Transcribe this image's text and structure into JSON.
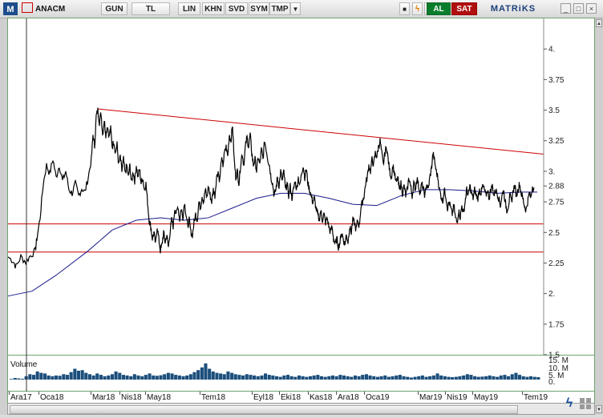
{
  "toolbar": {
    "menu_icon_label": "M",
    "symbol": "ANACM",
    "buttons": [
      "GUN",
      "TL",
      "LIN",
      "KHN",
      "SVD",
      "SYM",
      "TMP"
    ],
    "buy_label": "AL",
    "sell_label": "SAT",
    "brand": "MATRiKS"
  },
  "volume_label": "Volume",
  "colors": {
    "price_line": "#000000",
    "moving_average": "#1a1a8c",
    "trend_line": "#cc0000",
    "support_line": "#cc0000",
    "volume_bar": "#1c4f7c",
    "buy": "#0a7d2c",
    "sell": "#b01010"
  },
  "chart_data": {
    "type": "line",
    "series": [],
    "y_ticks": [
      "4.",
      "3.75",
      "3.5",
      "3.25",
      "3.",
      "2.88",
      "2.75",
      "2.5",
      "2.25",
      "2.",
      "1.75",
      "1.5"
    ],
    "y_tick_values": [
      4.0,
      3.75,
      3.5,
      3.25,
      3.0,
      2.88,
      2.75,
      2.5,
      2.25,
      2.0,
      1.75,
      1.5
    ],
    "ylim": [
      1.5,
      4.25
    ],
    "last_value": 2.88,
    "x_ticks": [
      "Ara17",
      "Oca18",
      "Mar18",
      "Nis18",
      "May18",
      "Tem18",
      "Eyl18",
      "Eki18",
      "Kas18",
      "Ara18",
      "Oca19",
      "Mar19",
      "Nis19",
      "May19",
      "Tem19"
    ],
    "volume_ticks": [
      "15. M",
      "10. M",
      "5. M",
      "0."
    ],
    "price_path": [
      [
        0,
        2.3
      ],
      [
        6,
        2.27
      ],
      [
        10,
        2.22
      ],
      [
        16,
        2.3
      ],
      [
        22,
        2.26
      ],
      [
        28,
        2.31
      ],
      [
        34,
        2.35
      ],
      [
        36,
        2.45
      ],
      [
        40,
        2.62
      ],
      [
        44,
        2.9
      ],
      [
        48,
        3.05
      ],
      [
        52,
        2.98
      ],
      [
        56,
        3.1
      ],
      [
        60,
        2.95
      ],
      [
        64,
        3.05
      ],
      [
        68,
        2.92
      ],
      [
        72,
        3.0
      ],
      [
        76,
        2.85
      ],
      [
        80,
        2.82
      ],
      [
        84,
        2.9
      ],
      [
        88,
        2.8
      ],
      [
        92,
        2.86
      ],
      [
        96,
        2.83
      ],
      [
        100,
        2.95
      ],
      [
        104,
        3.1
      ],
      [
        106,
        3.3
      ],
      [
        108,
        3.2
      ],
      [
        110,
        3.45
      ],
      [
        112,
        3.5
      ],
      [
        114,
        3.4
      ],
      [
        116,
        3.48
      ],
      [
        118,
        3.3
      ],
      [
        120,
        3.42
      ],
      [
        122,
        3.3
      ],
      [
        124,
        3.38
      ],
      [
        126,
        3.28
      ],
      [
        128,
        3.35
      ],
      [
        130,
        3.2
      ],
      [
        132,
        3.25
      ],
      [
        134,
        3.15
      ],
      [
        136,
        3.22
      ],
      [
        138,
        3.05
      ],
      [
        140,
        3.12
      ],
      [
        142,
        3.0
      ],
      [
        144,
        3.1
      ],
      [
        146,
        2.98
      ],
      [
        148,
        3.05
      ],
      [
        150,
        2.95
      ],
      [
        152,
        3.05
      ],
      [
        154,
        2.9
      ],
      [
        156,
        3.0
      ],
      [
        158,
        2.92
      ],
      [
        160,
        3.05
      ],
      [
        162,
        2.95
      ],
      [
        164,
        3.02
      ],
      [
        166,
        2.9
      ],
      [
        168,
        2.95
      ],
      [
        170,
        2.85
      ],
      [
        172,
        2.9
      ],
      [
        174,
        2.75
      ],
      [
        176,
        2.6
      ],
      [
        178,
        2.55
      ],
      [
        180,
        2.45
      ],
      [
        182,
        2.5
      ],
      [
        184,
        2.4
      ],
      [
        186,
        2.55
      ],
      [
        188,
        2.45
      ],
      [
        190,
        2.35
      ],
      [
        192,
        2.4
      ],
      [
        194,
        2.5
      ],
      [
        196,
        2.42
      ],
      [
        198,
        2.48
      ],
      [
        200,
        2.38
      ],
      [
        202,
        2.5
      ],
      [
        204,
        2.6
      ],
      [
        206,
        2.55
      ],
      [
        208,
        2.7
      ],
      [
        210,
        2.65
      ],
      [
        212,
        2.72
      ],
      [
        214,
        2.6
      ],
      [
        216,
        2.7
      ],
      [
        218,
        2.62
      ],
      [
        220,
        2.75
      ],
      [
        222,
        2.65
      ],
      [
        224,
        2.55
      ],
      [
        226,
        2.6
      ],
      [
        228,
        2.5
      ],
      [
        230,
        2.48
      ],
      [
        232,
        2.58
      ],
      [
        234,
        2.65
      ],
      [
        236,
        2.6
      ],
      [
        238,
        2.75
      ],
      [
        240,
        2.7
      ],
      [
        242,
        2.8
      ],
      [
        244,
        2.75
      ],
      [
        246,
        2.85
      ],
      [
        248,
        2.78
      ],
      [
        250,
        2.88
      ],
      [
        252,
        2.8
      ],
      [
        254,
        2.75
      ],
      [
        256,
        2.85
      ],
      [
        258,
        2.8
      ],
      [
        260,
        2.95
      ],
      [
        262,
        3.0
      ],
      [
        264,
        2.92
      ],
      [
        266,
        3.1
      ],
      [
        268,
        3.05
      ],
      [
        270,
        3.15
      ],
      [
        272,
        3.2
      ],
      [
        274,
        3.12
      ],
      [
        276,
        3.3
      ],
      [
        278,
        3.25
      ],
      [
        280,
        3.38
      ],
      [
        282,
        3.1
      ],
      [
        284,
        2.95
      ],
      [
        286,
        3.0
      ],
      [
        288,
        2.9
      ],
      [
        290,
        3.05
      ],
      [
        292,
        3.15
      ],
      [
        294,
        3.05
      ],
      [
        296,
        3.2
      ],
      [
        298,
        3.28
      ],
      [
        300,
        3.2
      ],
      [
        302,
        3.3
      ],
      [
        304,
        3.15
      ],
      [
        306,
        3.05
      ],
      [
        308,
        3.1
      ],
      [
        310,
        3.0
      ],
      [
        312,
        3.12
      ],
      [
        314,
        3.05
      ],
      [
        316,
        3.18
      ],
      [
        318,
        3.1
      ],
      [
        320,
        3.25
      ],
      [
        322,
        3.18
      ],
      [
        324,
        3.1
      ],
      [
        326,
        3.05
      ],
      [
        328,
        2.95
      ],
      [
        330,
        2.9
      ],
      [
        332,
        2.8
      ],
      [
        334,
        2.85
      ],
      [
        336,
        2.95
      ],
      [
        338,
        2.88
      ],
      [
        340,
        3.0
      ],
      [
        342,
        2.92
      ],
      [
        344,
        3.0
      ],
      [
        346,
        2.85
      ],
      [
        348,
        2.9
      ],
      [
        350,
        2.8
      ],
      [
        352,
        2.88
      ],
      [
        354,
        2.78
      ],
      [
        356,
        2.85
      ],
      [
        358,
        2.92
      ],
      [
        360,
        2.85
      ],
      [
        362,
        2.95
      ],
      [
        364,
        2.88
      ],
      [
        366,
        2.98
      ],
      [
        368,
        3.05
      ],
      [
        370,
        2.95
      ],
      [
        372,
        3.02
      ],
      [
        374,
        2.9
      ],
      [
        376,
        2.85
      ],
      [
        378,
        2.8
      ],
      [
        380,
        2.75
      ],
      [
        382,
        2.78
      ],
      [
        384,
        2.7
      ],
      [
        386,
        2.65
      ],
      [
        388,
        2.6
      ],
      [
        390,
        2.68
      ],
      [
        392,
        2.6
      ],
      [
        394,
        2.65
      ],
      [
        396,
        2.58
      ],
      [
        398,
        2.62
      ],
      [
        400,
        2.55
      ],
      [
        402,
        2.5
      ],
      [
        404,
        2.55
      ],
      [
        406,
        2.45
      ],
      [
        408,
        2.4
      ],
      [
        410,
        2.45
      ],
      [
        412,
        2.38
      ],
      [
        414,
        2.42
      ],
      [
        416,
        2.5
      ],
      [
        418,
        2.45
      ],
      [
        420,
        2.4
      ],
      [
        422,
        2.48
      ],
      [
        424,
        2.42
      ],
      [
        426,
        2.55
      ],
      [
        428,
        2.5
      ],
      [
        430,
        2.6
      ],
      [
        432,
        2.58
      ],
      [
        434,
        2.52
      ],
      [
        436,
        2.6
      ],
      [
        438,
        2.55
      ],
      [
        440,
        2.7
      ],
      [
        442,
        2.75
      ],
      [
        444,
        2.8
      ],
      [
        446,
        2.9
      ],
      [
        448,
        2.95
      ],
      [
        450,
        3.05
      ],
      [
        452,
        3.0
      ],
      [
        454,
        3.1
      ],
      [
        456,
        3.05
      ],
      [
        458,
        3.15
      ],
      [
        460,
        3.12
      ],
      [
        462,
        3.2
      ],
      [
        464,
        3.25
      ],
      [
        466,
        3.15
      ],
      [
        468,
        3.05
      ],
      [
        470,
        3.15
      ],
      [
        472,
        3.2
      ],
      [
        474,
        3.1
      ],
      [
        476,
        3.0
      ],
      [
        478,
        2.95
      ],
      [
        480,
        3.05
      ],
      [
        482,
        2.98
      ],
      [
        484,
        2.9
      ],
      [
        486,
        2.95
      ],
      [
        488,
        2.85
      ],
      [
        490,
        2.9
      ],
      [
        492,
        2.82
      ],
      [
        494,
        2.88
      ],
      [
        496,
        2.8
      ],
      [
        498,
        2.85
      ],
      [
        500,
        2.95
      ],
      [
        502,
        2.88
      ],
      [
        504,
        2.8
      ],
      [
        506,
        2.9
      ],
      [
        508,
        2.85
      ],
      [
        510,
        2.95
      ],
      [
        512,
        2.88
      ],
      [
        514,
        2.82
      ],
      [
        516,
        2.9
      ],
      [
        518,
        2.85
      ],
      [
        520,
        2.8
      ],
      [
        522,
        2.9
      ],
      [
        524,
        2.85
      ],
      [
        526,
        2.95
      ],
      [
        528,
        3.02
      ],
      [
        530,
        3.15
      ],
      [
        532,
        3.08
      ],
      [
        534,
        3.0
      ],
      [
        536,
        2.95
      ],
      [
        538,
        2.85
      ],
      [
        540,
        2.8
      ],
      [
        542,
        2.75
      ],
      [
        544,
        2.85
      ],
      [
        546,
        2.8
      ],
      [
        548,
        2.7
      ],
      [
        550,
        2.75
      ],
      [
        552,
        2.7
      ],
      [
        554,
        2.65
      ],
      [
        556,
        2.72
      ],
      [
        558,
        2.62
      ],
      [
        560,
        2.58
      ],
      [
        562,
        2.68
      ],
      [
        564,
        2.62
      ],
      [
        566,
        2.72
      ],
      [
        568,
        2.65
      ],
      [
        570,
        2.75
      ],
      [
        572,
        2.85
      ],
      [
        574,
        2.8
      ],
      [
        576,
        2.88
      ],
      [
        578,
        2.82
      ],
      [
        580,
        2.78
      ],
      [
        582,
        2.85
      ],
      [
        584,
        2.8
      ],
      [
        586,
        2.78
      ],
      [
        588,
        2.85
      ],
      [
        590,
        2.82
      ],
      [
        592,
        2.88
      ],
      [
        594,
        2.85
      ],
      [
        596,
        2.8
      ],
      [
        598,
        2.85
      ],
      [
        600,
        2.78
      ],
      [
        602,
        2.85
      ],
      [
        604,
        2.88
      ],
      [
        606,
        2.8
      ],
      [
        608,
        2.85
      ],
      [
        610,
        2.82
      ],
      [
        612,
        2.78
      ],
      [
        614,
        2.72
      ],
      [
        616,
        2.8
      ],
      [
        618,
        2.85
      ],
      [
        620,
        2.75
      ],
      [
        622,
        2.68
      ],
      [
        624,
        2.72
      ],
      [
        626,
        2.8
      ],
      [
        628,
        2.75
      ],
      [
        630,
        2.85
      ],
      [
        632,
        2.88
      ],
      [
        634,
        2.8
      ],
      [
        636,
        2.85
      ],
      [
        638,
        2.9
      ],
      [
        640,
        2.82
      ],
      [
        642,
        2.78
      ],
      [
        644,
        2.72
      ],
      [
        646,
        2.68
      ],
      [
        648,
        2.75
      ],
      [
        650,
        2.82
      ],
      [
        652,
        2.78
      ],
      [
        654,
        2.88
      ],
      [
        656,
        2.85
      ]
    ],
    "moving_average_path": [
      [
        0,
        1.98
      ],
      [
        30,
        2.02
      ],
      [
        60,
        2.15
      ],
      [
        100,
        2.35
      ],
      [
        130,
        2.52
      ],
      [
        160,
        2.6
      ],
      [
        190,
        2.62
      ],
      [
        220,
        2.6
      ],
      [
        250,
        2.62
      ],
      [
        280,
        2.7
      ],
      [
        310,
        2.78
      ],
      [
        340,
        2.82
      ],
      [
        370,
        2.82
      ],
      [
        400,
        2.78
      ],
      [
        430,
        2.73
      ],
      [
        460,
        2.72
      ],
      [
        490,
        2.8
      ],
      [
        520,
        2.85
      ],
      [
        550,
        2.85
      ],
      [
        580,
        2.84
      ],
      [
        610,
        2.82
      ],
      [
        640,
        2.83
      ],
      [
        660,
        2.83
      ]
    ],
    "trend_line": [
      [
        112,
        3.51
      ],
      [
        668,
        3.14
      ]
    ],
    "support_levels": [
      2.57,
      2.34
    ],
    "volume_values": [
      0.5,
      1.2,
      0.8,
      0.6,
      2.5,
      4.0,
      3.5,
      6.0,
      5.0,
      4.5,
      3.0,
      2.5,
      3.0,
      2.8,
      4.0,
      3.5,
      5.5,
      8.0,
      6.5,
      7.0,
      5.0,
      4.0,
      3.0,
      4.5,
      3.5,
      2.5,
      3.0,
      4.0,
      6.0,
      5.0,
      3.5,
      3.0,
      2.5,
      4.0,
      3.0,
      2.5,
      3.5,
      4.5,
      3.0,
      2.8,
      3.2,
      4.0,
      5.0,
      4.5,
      3.5,
      3.0,
      2.5,
      3.0,
      4.0,
      5.5,
      7.0,
      9.0,
      12.0,
      8.0,
      6.0,
      5.0,
      4.5,
      4.0,
      6.0,
      5.0,
      4.0,
      3.5,
      3.0,
      4.0,
      3.5,
      3.0,
      2.5,
      3.0,
      4.5,
      3.5,
      3.0,
      2.5,
      2.0,
      3.0,
      3.5,
      2.5,
      2.0,
      3.0,
      2.5,
      2.0,
      2.5,
      3.0,
      3.5,
      2.5,
      2.0,
      2.5,
      3.0,
      2.5,
      3.5,
      3.0,
      2.5,
      2.0,
      3.0,
      2.5,
      3.5,
      4.0,
      3.0,
      2.5,
      2.0,
      2.5,
      3.0,
      2.0,
      2.5,
      3.0,
      3.5,
      2.5,
      2.0,
      1.5,
      2.0,
      2.5,
      3.0,
      2.0,
      2.5,
      3.0,
      4.5,
      3.0,
      2.5,
      2.0,
      1.8,
      2.0,
      2.5,
      3.0,
      4.0,
      3.5,
      2.5,
      2.0,
      2.2,
      2.5,
      3.0,
      2.5,
      2.0,
      3.0,
      3.5,
      2.5,
      4.0,
      5.0,
      3.5,
      2.5,
      2.0,
      2.5,
      2.0,
      1.8
    ]
  },
  "scroll": {
    "prev_label": "◄",
    "next_label": "►"
  }
}
